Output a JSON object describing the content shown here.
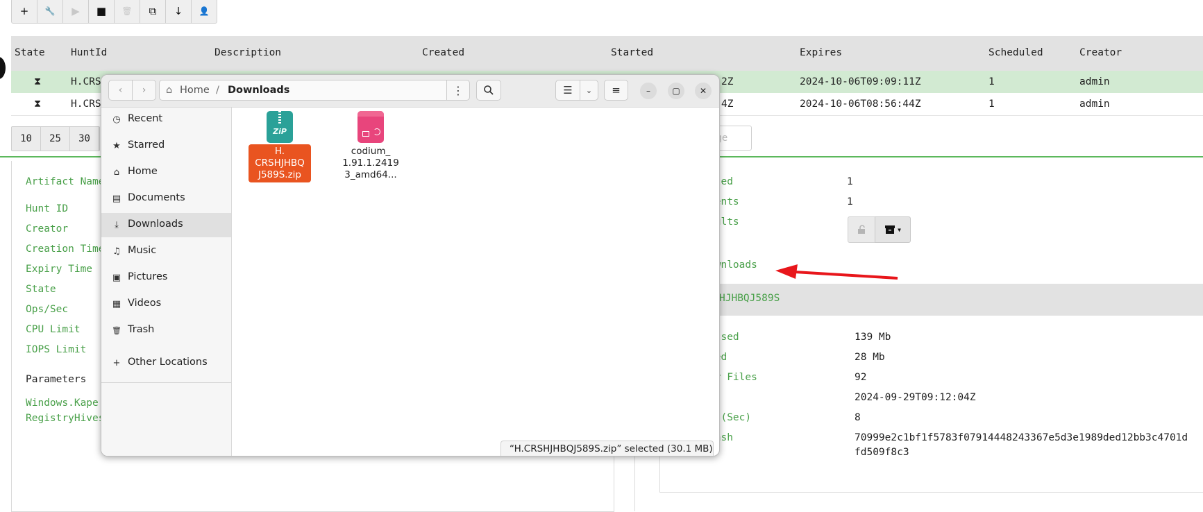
{
  "toolbar": {
    "buttons": [
      {
        "icon": "plus-icon",
        "glyph": "+"
      },
      {
        "icon": "wrench-icon",
        "glyph": "🔧"
      },
      {
        "icon": "play-icon",
        "glyph": "▶"
      },
      {
        "icon": "stop-icon",
        "glyph": "■"
      },
      {
        "icon": "trash-icon",
        "glyph": "🗑"
      },
      {
        "icon": "copy-icon",
        "glyph": "⧉"
      },
      {
        "icon": "download-icon",
        "glyph": "↓"
      },
      {
        "icon": "user-icon",
        "glyph": "👤"
      }
    ]
  },
  "hunts_table": {
    "columns": [
      "State",
      "HuntId",
      "Description",
      "Created",
      "Started",
      "Expires",
      "Scheduled",
      "Creator"
    ],
    "rows": [
      {
        "state_icon": "⧗",
        "hunt_id": "H.CRS",
        "started_tail": "2Z",
        "expires": "2024-10-06T09:09:11Z",
        "scheduled": "1",
        "creator": "admin"
      },
      {
        "state_icon": "⧗",
        "hunt_id": "H.CRS",
        "started_tail": "4Z",
        "expires": "2024-10-06T08:56:44Z",
        "scheduled": "1",
        "creator": "admin"
      }
    ]
  },
  "pager": {
    "sizes": [
      "10",
      "25",
      "30"
    ],
    "goto_placeholder": "age"
  },
  "details_left": {
    "labels": [
      "Artifact Name",
      "Hunt ID",
      "Creator",
      "Creation Time",
      "Expiry Time",
      "State",
      "Ops/Sec",
      "CPU Limit",
      "IOPS Limit"
    ],
    "parameters_heading": "Parameters",
    "param_lines": [
      "Windows.Kape",
      "RegistryHives"
    ]
  },
  "details_right": {
    "stats": [
      {
        "label": "uled",
        "value": "1"
      },
      {
        "label": "ients",
        "value": "1"
      },
      {
        "label": "sults",
        "value": ""
      }
    ],
    "downloads_label": "ownloads",
    "export_title": "HJHBQJ589S",
    "export_rows": [
      {
        "label": "essed",
        "value": "139 Mb"
      },
      {
        "label": "sed",
        "value": "28 Mb"
      },
      {
        "label": "er Files",
        "value": "92"
      },
      {
        "label": "",
        "value": "2024-09-29T09:12:04Z"
      },
      {
        "label": "n (Sec)",
        "value": "8"
      },
      {
        "label": "Hash",
        "value": "70999e2c1bf1f5783f07914448243367e5d3e1989ded12bb3c4701d"
      },
      {
        "label": "",
        "value": "fd509f8c3"
      }
    ]
  },
  "file_manager": {
    "path": {
      "home": "Home",
      "separator": "/",
      "current": "Downloads"
    },
    "sidebar": [
      {
        "label": "Recent",
        "icon": "clock-icon",
        "glyph": "◷"
      },
      {
        "label": "Starred",
        "icon": "star-icon",
        "glyph": "★"
      },
      {
        "label": "Home",
        "icon": "home-icon",
        "glyph": "⌂"
      },
      {
        "label": "Documents",
        "icon": "document-icon",
        "glyph": "▤"
      },
      {
        "label": "Downloads",
        "icon": "downloads-icon",
        "glyph": "⤓",
        "active": true
      },
      {
        "label": "Music",
        "icon": "music-icon",
        "glyph": "♫"
      },
      {
        "label": "Pictures",
        "icon": "picture-icon",
        "glyph": "▣"
      },
      {
        "label": "Videos",
        "icon": "video-icon",
        "glyph": "▦"
      },
      {
        "label": "Trash",
        "icon": "trash-icon",
        "glyph": "🗑"
      },
      {
        "label": "Other Locations",
        "icon": "plus-icon",
        "glyph": "+"
      }
    ],
    "files": [
      {
        "name_lines": [
          "H.",
          "CRSHJHBQ",
          "J589S.zip"
        ],
        "icon_label": "ZiP",
        "selected": true,
        "color": "#2aa198"
      },
      {
        "name_lines": [
          "codium_",
          "1.91.1.2419",
          "3_amd64..."
        ],
        "icon_label": "",
        "selected": false,
        "color": "#e8457c"
      }
    ],
    "status": "“H.CRSHJHBQJ589S.zip” selected  (30.1 MB)"
  },
  "colors": {
    "accent_green": "#49a049",
    "selection_orange": "#e95420",
    "arrow_red": "#e8161b"
  }
}
